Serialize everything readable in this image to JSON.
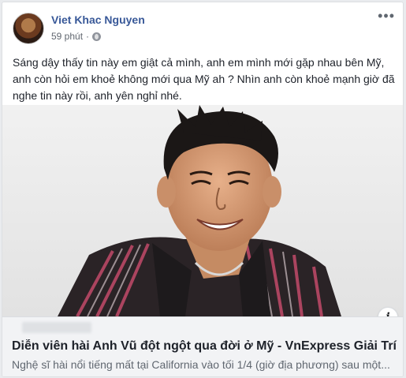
{
  "post": {
    "author": "Viet Khac Nguyen",
    "time": "59 phút",
    "privacy_separator": "·",
    "more_label": "•••",
    "text": "Sáng dậy thấy tin này em giật cả mình, anh em mình mới gặp nhau bên Mỹ, anh còn hỏi em khoẻ không mới qua Mỹ ah ? Nhìn anh còn khoẻ mạnh giờ đã nghe tin này rồi, anh yên nghỉ nhé."
  },
  "link": {
    "title": "Diễn viên hài Anh Vũ đột ngột qua đời ở Mỹ - VnExpress Giải Trí",
    "description": "Nghệ sĩ hài nổi tiếng mất tại California vào tối 1/4 (giờ địa phương) sau một...",
    "info_label": "i"
  },
  "icons": {
    "privacy": "globe-icon",
    "more": "more-options-icon",
    "info": "info-icon"
  },
  "colors": {
    "author": "#385898",
    "link_bg": "#f2f3f5"
  }
}
